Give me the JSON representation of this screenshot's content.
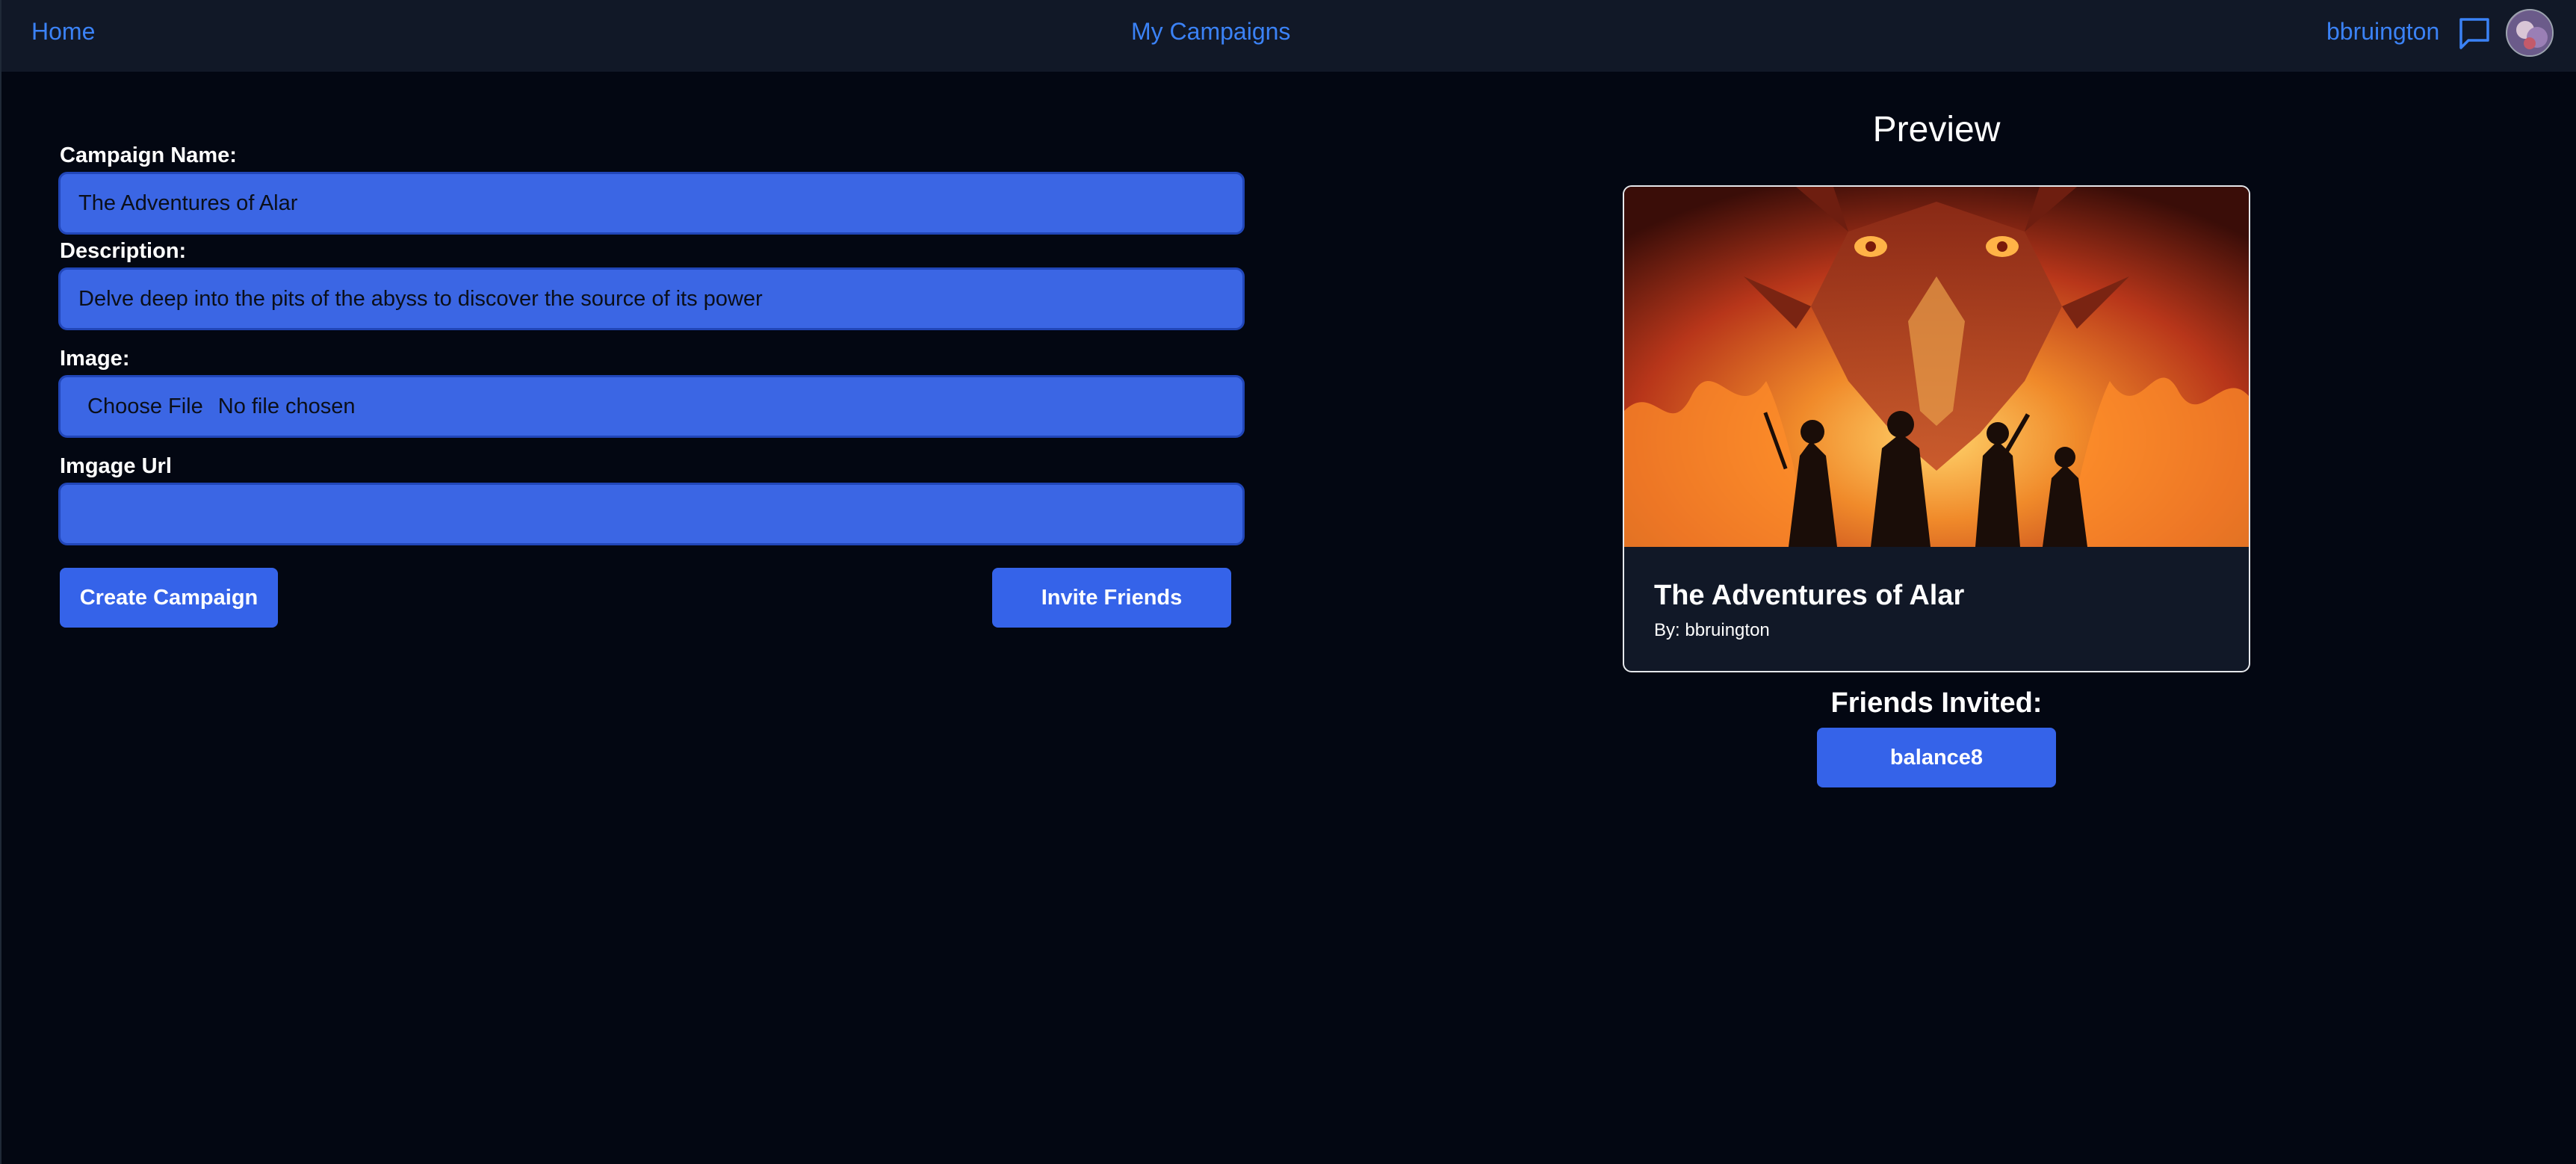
{
  "nav": {
    "home": "Home",
    "campaigns": "My Campaigns",
    "username": "bbruington"
  },
  "form": {
    "name_label": "Campaign Name:",
    "name_value": "The Adventures of Alar",
    "description_label": "Description:",
    "description_value": "Delve deep into the pits of the abyss to discover the source of its power",
    "image_label": "Image:",
    "file_button": "Choose File",
    "file_status": "No file chosen",
    "image_url_label": "Imgage Url",
    "image_url_value": "",
    "create_button": "Create Campaign",
    "invite_button": "Invite Friends"
  },
  "preview": {
    "title": "Preview",
    "card_title": "The Adventures of Alar",
    "card_author": "By: bbruington",
    "friends_title": "Friends Invited:",
    "friends": [
      "balance8"
    ]
  },
  "colors": {
    "background": "#030712",
    "navbar": "#111827",
    "accent": "#3b82f6",
    "field": "#3b66e4",
    "button": "#3563e9"
  }
}
